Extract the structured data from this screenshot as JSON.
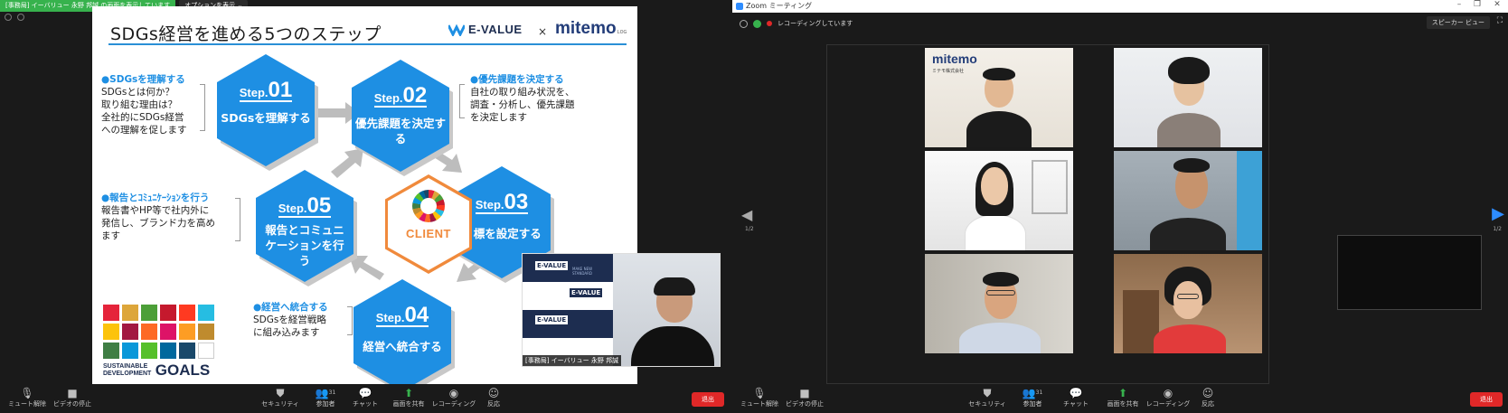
{
  "left": {
    "banner_text": "[事務局] イーバリュー 永野 邦誠 の画面を表示しています",
    "options_label": "オプションを表示 ⌄",
    "slide": {
      "title": "SDGs経営を進める5つのステップ",
      "brand_evalue": "E-VALUE",
      "brand_x": "×",
      "brand_mitemo": "mitemo",
      "brand_mitemo_sub": "LOG",
      "steps": [
        {
          "prefix": "Step.",
          "num": "01",
          "name": "SDGsを理解する"
        },
        {
          "prefix": "Step.",
          "num": "02",
          "name": "優先課題を決定する"
        },
        {
          "prefix": "Step.",
          "num": "03",
          "name": "目標を設定する"
        },
        {
          "prefix": "Step.",
          "num": "04",
          "name": "経営へ統合する"
        },
        {
          "prefix": "Step.",
          "num": "05",
          "name": "報告とコミュニケーションを行う"
        }
      ],
      "client_label": "CLIENT",
      "desc1": {
        "head": "●SDGsを理解する",
        "lines": [
          "SDGsとは何か？",
          "取り組む理由は？",
          "全社的にSDGs経営",
          "への理解を促します"
        ]
      },
      "desc2": {
        "head": "●優先課題を決定する",
        "lines": [
          "自社の取り組み状況を、",
          "調査・分析し、優先課題",
          "を決定します"
        ]
      },
      "desc5": {
        "head": "●報告とｺﾐｭﾆｹｰｼｮﾝを行う",
        "lines": [
          "報告書やHP等で社内外に",
          "発信し、ブランド力を高め",
          "ます"
        ]
      },
      "desc4": {
        "head": "●経営へ統合する",
        "lines": [
          "SDGsを経営戦略",
          "に組み込みます"
        ]
      },
      "sdg_logo_small1": "SUSTAINABLE",
      "sdg_logo_small2": "DEVELOPMENT",
      "sdg_logo_big": "GOALS",
      "sdg_colors": [
        "#e5243b",
        "#dda63a",
        "#4c9f38",
        "#c5192d",
        "#ff3a21",
        "#26bde2",
        "#fcc30b",
        "#a21942",
        "#fd6925",
        "#dd1367",
        "#fd9d24",
        "#bf8b2e",
        "#3f7e44",
        "#0a97d9",
        "#56c02b",
        "#00689d",
        "#19486a",
        "#ffffff"
      ]
    },
    "thumb": {
      "caption": "[事務局] イーバリュー 永野 邦誠",
      "brand": "E-VALUE",
      "tagline": "MAKE NEW STANDARD"
    },
    "toolbar": {
      "mute": "ミュート解除",
      "video": "ビデオの停止",
      "security": "セキュリティ",
      "participants": "参加者",
      "participants_count": "31",
      "chat": "チャット",
      "share": "画面を共有",
      "record": "レコーディング",
      "reactions": "反応",
      "end": "退出"
    }
  },
  "right": {
    "window_title": "Zoom ミーティング",
    "recording_text": "レコーディングしています",
    "speaker_view": "スピーカー ビュー",
    "page_left": "1/2",
    "page_right": "1/2",
    "tile_logo": "mitemo",
    "tile_logo_sub": "ミテモ株式会社",
    "toolbar": {
      "mute": "ミュート解除",
      "video": "ビデオの停止",
      "security": "セキュリティ",
      "participants": "参加者",
      "participants_count": "31",
      "chat": "チャット",
      "share": "画面を共有",
      "record": "レコーディング",
      "reactions": "反応",
      "end": "退出"
    }
  },
  "colors": {
    "step_blue": "#1e8fe3",
    "client_orange": "#f08a3c",
    "end_red": "#e02828",
    "share_green": "#37b24d",
    "zoom_blue": "#2d8cff"
  }
}
